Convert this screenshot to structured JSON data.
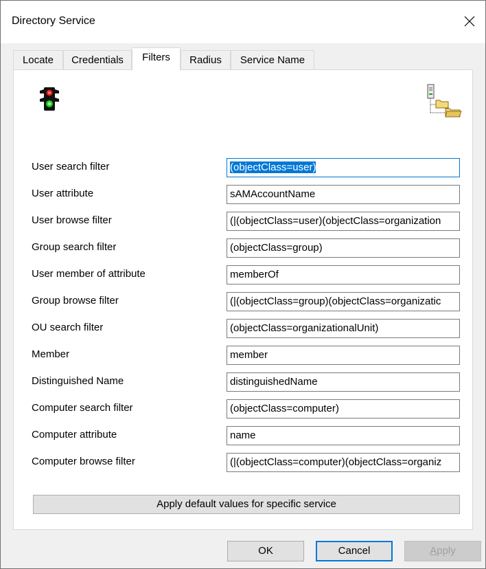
{
  "window": {
    "title": "Directory Service"
  },
  "tabs": [
    {
      "label": "Locate"
    },
    {
      "label": "Credentials"
    },
    {
      "label": "Filters"
    },
    {
      "label": "Radius"
    },
    {
      "label": "Service Name"
    }
  ],
  "icons": {
    "left": "traffic-light-icon",
    "right": "directory-tree-icon"
  },
  "fields": [
    {
      "label": "User search filter",
      "value": "(objectClass=user)"
    },
    {
      "label": "User attribute",
      "value": "sAMAccountName"
    },
    {
      "label": "User browse filter",
      "value": "(|(objectClass=user)(objectClass=organization"
    },
    {
      "label": "Group search filter",
      "value": "(objectClass=group)"
    },
    {
      "label": "User member of attribute",
      "value": "memberOf"
    },
    {
      "label": "Group browse filter",
      "value": "(|(objectClass=group)(objectClass=organizatic"
    },
    {
      "label": "OU search filter",
      "value": "(objectClass=organizationalUnit)"
    },
    {
      "label": "Member",
      "value": "member"
    },
    {
      "label": "Distinguished Name",
      "value": "distinguishedName"
    },
    {
      "label": "Computer search filter",
      "value": "(objectClass=computer)"
    },
    {
      "label": "Computer attribute",
      "value": "name"
    },
    {
      "label": "Computer browse filter",
      "value": "(|(objectClass=computer)(objectClass=organiz"
    }
  ],
  "apply_default_label": "Apply default values for specific service",
  "buttons": {
    "ok": "OK",
    "cancel": "Cancel",
    "apply": "Apply"
  },
  "colors": {
    "accent": "#0078d7",
    "selection": "#0078d7"
  }
}
